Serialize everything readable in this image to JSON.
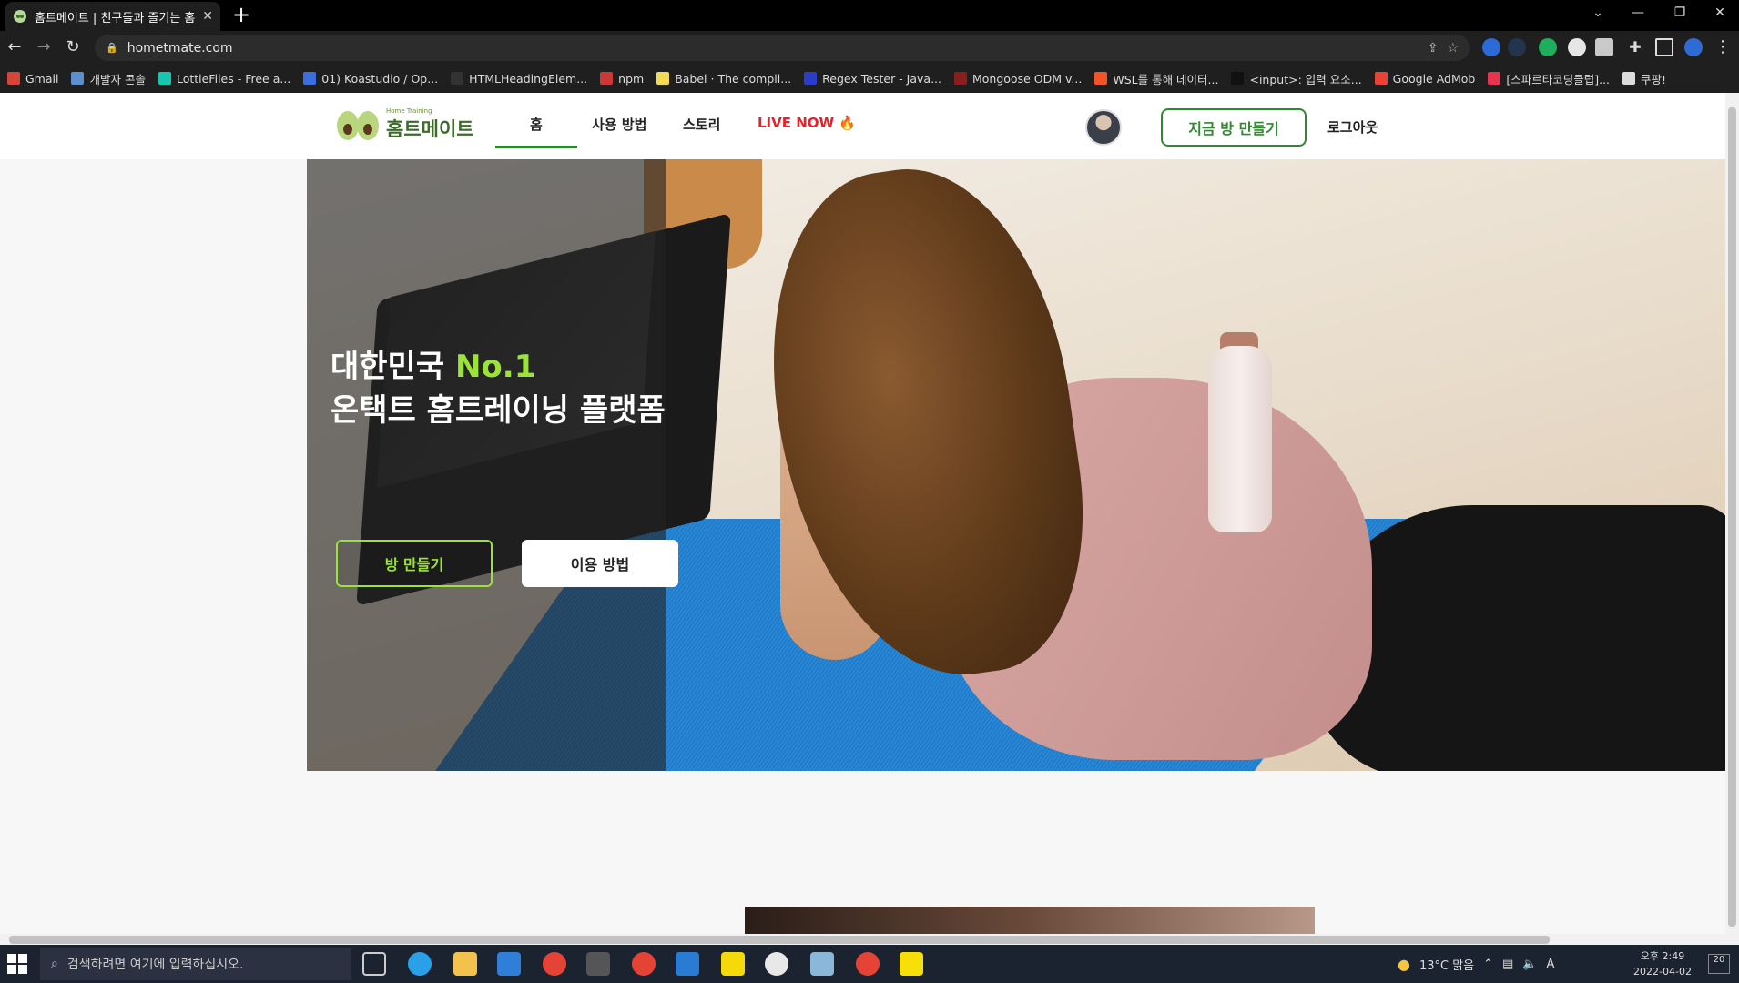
{
  "browser": {
    "tab_title": "홈트메이트 | 친구들과 즐기는 홈",
    "url": "hometmate.com",
    "bookmarks": [
      {
        "label": "Gmail",
        "color": "#d64537"
      },
      {
        "label": "개발자 콘솔",
        "color": "#5b8fd0"
      },
      {
        "label": "LottieFiles - Free a...",
        "color": "#16c6b1"
      },
      {
        "label": "01) Koastudio / Op...",
        "color": "#3b6fe0"
      },
      {
        "label": "HTMLHeadingElem...",
        "color": "#333333"
      },
      {
        "label": "npm",
        "color": "#cb3837"
      },
      {
        "label": "Babel · The compil...",
        "color": "#f5da55"
      },
      {
        "label": "Regex Tester - Java...",
        "color": "#2a3cc8"
      },
      {
        "label": "Mongoose ODM v...",
        "color": "#8a1d1d"
      },
      {
        "label": "WSL를 통해 데이터...",
        "color": "#f35325"
      },
      {
        "label": "<input>: 입력 요소...",
        "color": "#111111"
      },
      {
        "label": "Google AdMob",
        "color": "#ea4335"
      },
      {
        "label": "[스파르타코딩클럽]...",
        "color": "#e8344e"
      },
      {
        "label": "쿠팡!",
        "color": "#dddddd"
      }
    ]
  },
  "site": {
    "logo_small": "Home Training",
    "logo_text": "홈트메이트",
    "nav": {
      "home": "홈",
      "howto": "사용 방법",
      "story": "스토리",
      "live": "LIVE NOW",
      "live_icon": "fire-emoji",
      "live_emoji": "🔥"
    },
    "create_now": "지금 방 만들기",
    "logout": "로그아웃",
    "hero": {
      "line1_prefix": "대한민국",
      "line1_accent": "No.1",
      "line2": "온택트 홈트레이닝 플랫폼",
      "btn_create": "방 만들기",
      "btn_howto": "이용 방법"
    },
    "colors": {
      "accent_green": "#9be23a",
      "brand_green": "#2f8a2f",
      "live_red": "#e8202a"
    }
  },
  "taskbar": {
    "search_placeholder": "검색하려면 여기에 입력하십시오.",
    "weather": "13°C  맑음",
    "time_ampm": "오후 2:49",
    "date": "2022-04-02",
    "notif_count": "20",
    "lang": "A"
  }
}
